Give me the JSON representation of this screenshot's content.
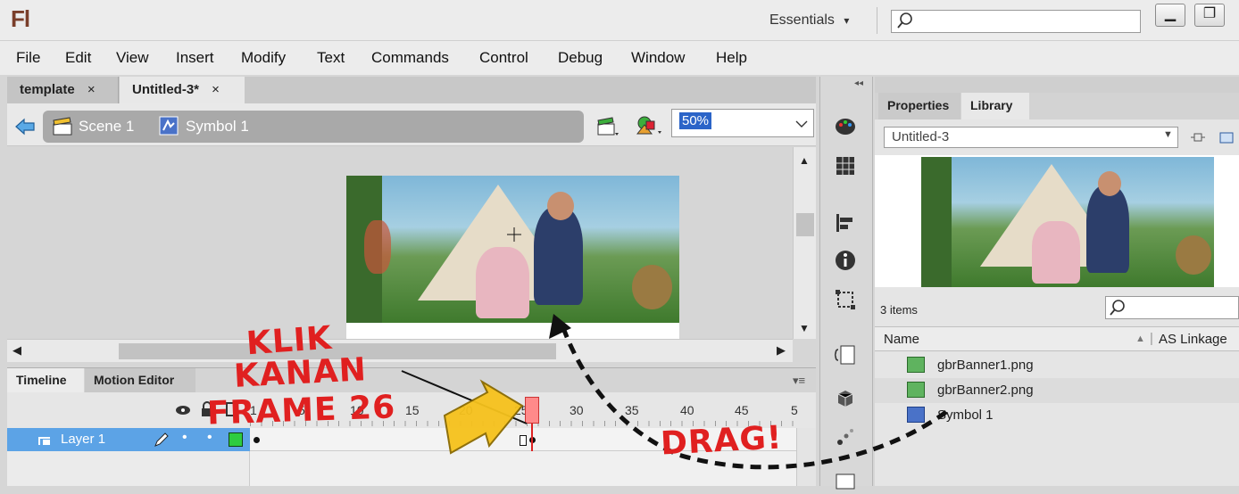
{
  "app": {
    "logo": "Fl",
    "workspace": "Essentials",
    "workspace_arrow": "▾",
    "window_minimize": "▁",
    "window_restore": "❐"
  },
  "menu": [
    "File",
    "Edit",
    "View",
    "Insert",
    "Modify",
    "Text",
    "Commands",
    "Control",
    "Debug",
    "Window",
    "Help"
  ],
  "doc_tabs": [
    {
      "label": "template",
      "close": "×"
    },
    {
      "label": "Untitled-3*",
      "close": "×"
    }
  ],
  "editbar": {
    "scene": "Scene 1",
    "symbol": "Symbol 1",
    "zoom": "50%"
  },
  "timeline": {
    "tabs": [
      "Timeline",
      "Motion Editor"
    ],
    "frame_numbers": [
      "1",
      "5",
      "10",
      "15",
      "20",
      "25",
      "30",
      "35",
      "40",
      "45",
      "5"
    ],
    "layer_name": "Layer 1",
    "current_frame": 25
  },
  "panel": {
    "tabs": [
      "Properties",
      "Library"
    ],
    "library_name": "Untitled-3",
    "items_count": "3 items",
    "col_name": "Name",
    "col_linkage": "AS Linkage",
    "items": [
      {
        "name": "gbrBanner1.png",
        "type": "bitmap"
      },
      {
        "name": "gbrBanner2.png",
        "type": "bitmap"
      },
      {
        "name": "Symbol 1",
        "type": "movieclip"
      }
    ]
  },
  "annotations": {
    "line1": "KLIK",
    "line2": "KANAN",
    "line3": "FRAME 26",
    "drag": "DRAG!"
  },
  "colors": {
    "layer_selected": "#5ca3e6",
    "playhead": "#dd2222",
    "annotation_red": "#e02020",
    "arrow_yellow": "#f6c21c"
  }
}
